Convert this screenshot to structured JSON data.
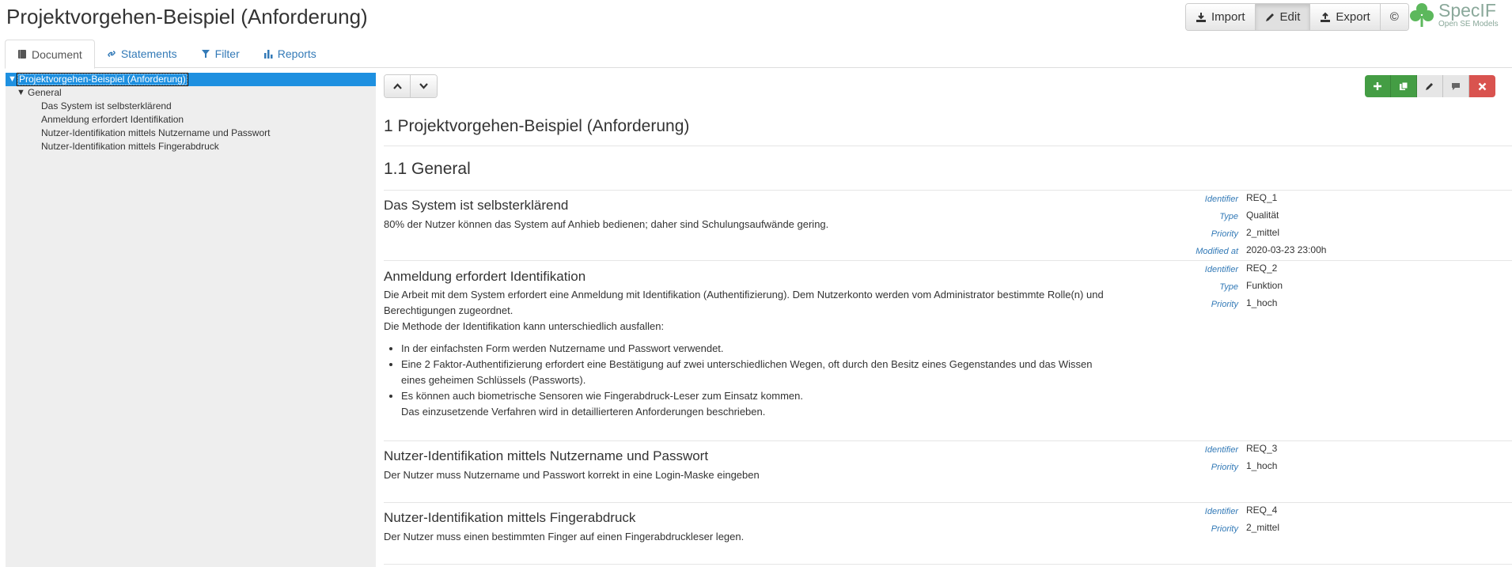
{
  "app": {
    "title": "Projektvorgehen-Beispiel (Anforderung)"
  },
  "toolbar": {
    "import_label": "Import",
    "edit_label": "Edit",
    "export_label": "Export",
    "about_label": "©"
  },
  "logo": {
    "name": "SpecIF",
    "subtitle": "Open SE Models"
  },
  "tabs": [
    {
      "label": "Document",
      "icon": "book-icon",
      "active": true
    },
    {
      "label": "Statements",
      "icon": "link-icon",
      "active": false
    },
    {
      "label": "Filter",
      "icon": "filter-icon",
      "active": false
    },
    {
      "label": "Reports",
      "icon": "bar-chart-icon",
      "active": false
    }
  ],
  "tree": {
    "root": "Projektvorgehen-Beispiel (Anforderung)",
    "folder": "General",
    "items": [
      "Das System ist selbsterklärend",
      "Anmeldung erfordert Identifikation",
      "Nutzer-Identifikation mittels Nutzername und Passwort",
      "Nutzer-Identifikation mittels Fingerabdruck"
    ]
  },
  "doc": {
    "heading1": "1 Projektvorgehen-Beispiel (Anforderung)",
    "heading2": "1.1 General"
  },
  "labels": {
    "identifier": "Identifier",
    "type": "Type",
    "priority": "Priority",
    "modified": "Modified at"
  },
  "resources": [
    {
      "title": "Das System ist selbsterklärend",
      "text": "80% der Nutzer können das System auf Anhieb bedienen; daher sind Schulungsaufwände gering.",
      "identifier": "REQ_1",
      "type": "Qualität",
      "priority": "2_mittel",
      "modified": "2020-03-23 23:00h"
    },
    {
      "title": "Anmeldung erfordert Identifikation",
      "text1": "Die Arbeit mit dem System erfordert eine Anmeldung mit Identifikation (Authentifizierung). Dem Nutzerkonto werden vom Administrator bestimmte Rolle(n) und Berechtigungen zugeordnet.",
      "text2": "Die Methode der Identifikation kann unterschiedlich ausfallen:",
      "bullets": [
        "In der einfachsten Form werden Nutzername und Passwort verwendet.",
        "Eine 2 Faktor-Authentifizierung erfordert eine Bestätigung auf zwei unterschiedlichen Wegen, oft durch den Besitz eines Gegenstandes und das Wissen eines geheimen Schlüssels (Passworts).",
        "Es können auch biometrische Sensoren wie Fingerabdruck-Leser zum Einsatz kommen."
      ],
      "bullet_tail": "Das einzusetzende Verfahren wird in detaillierteren Anforderungen beschrieben.",
      "identifier": "REQ_2",
      "type": "Funktion",
      "priority": "1_hoch"
    },
    {
      "title": "Nutzer-Identifikation mittels Nutzername und Passwort",
      "text": "Der Nutzer muss Nutzername und Passwort korrekt in eine Login-Maske eingeben",
      "identifier": "REQ_3",
      "priority": "1_hoch"
    },
    {
      "title": "Nutzer-Identifikation mittels Fingerabdruck",
      "text": "Der Nutzer muss einen bestimmten Finger auf einen Fingerabdruckleser legen.",
      "identifier": "REQ_4",
      "priority": "2_mittel"
    }
  ]
}
